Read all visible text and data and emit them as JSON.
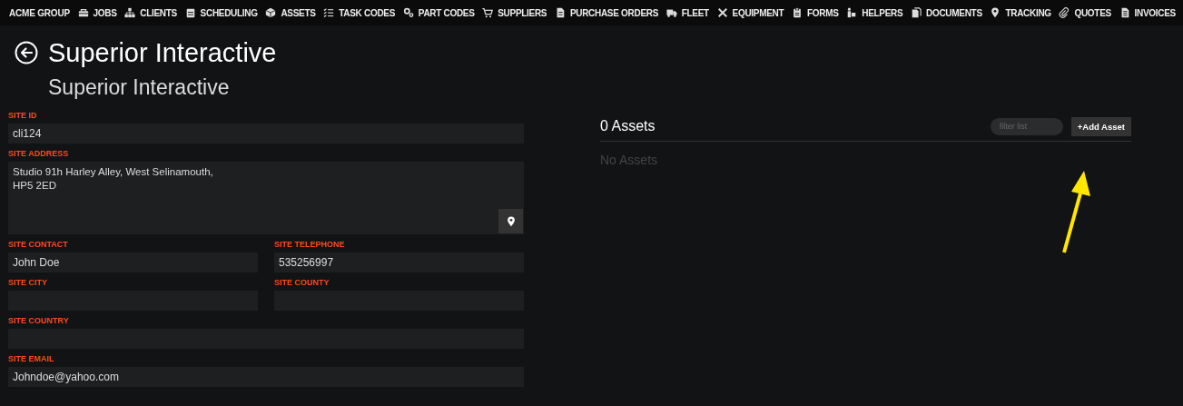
{
  "navbar": {
    "brand": "ACME GROUP",
    "items": [
      {
        "label": "JOBS"
      },
      {
        "label": "CLIENTS"
      },
      {
        "label": "SCHEDULING"
      },
      {
        "label": "ASSETS"
      },
      {
        "label": "TASK CODES"
      },
      {
        "label": "PART CODES"
      },
      {
        "label": "SUPPLIERS"
      },
      {
        "label": "PURCHASE ORDERS"
      },
      {
        "label": "FLEET"
      },
      {
        "label": "EQUIPMENT"
      },
      {
        "label": "FORMS"
      },
      {
        "label": "HELPERS"
      },
      {
        "label": "DOCUMENTS"
      },
      {
        "label": "TRACKING"
      },
      {
        "label": "QUOTES"
      },
      {
        "label": "INVOICES"
      }
    ]
  },
  "header": {
    "title": "Superior Interactive",
    "subtitle": "Superior Interactive"
  },
  "form": {
    "rows": [
      [
        {
          "kind": "text",
          "label": "SITE ID",
          "value": "cli124"
        }
      ],
      [
        {
          "kind": "textarea",
          "label": "SITE ADDRESS",
          "value": "Studio 91h Harley Alley, West Selinamouth,\nHP5 2ED"
        }
      ],
      [
        {
          "kind": "text",
          "label": "SITE CONTACT",
          "value": "John Doe"
        },
        {
          "kind": "text",
          "label": "SITE TELEPHONE",
          "value": "535256997"
        }
      ],
      [
        {
          "kind": "text",
          "label": "SITE CITY"
        },
        {
          "kind": "text",
          "label": "SITE COUNTY"
        }
      ],
      [
        {
          "kind": "text",
          "label": "SITE COUNTRY"
        }
      ],
      [
        {
          "kind": "text",
          "label": "SITE EMAIL",
          "value": "Johndoe@yahoo.com"
        }
      ]
    ]
  },
  "assets": {
    "title": "0 Assets",
    "filter": {
      "placeholder": "filter list"
    },
    "add_button": "+Add Asset",
    "empty_text": "No Assets"
  },
  "annotation": {
    "kind": "arrow"
  }
}
